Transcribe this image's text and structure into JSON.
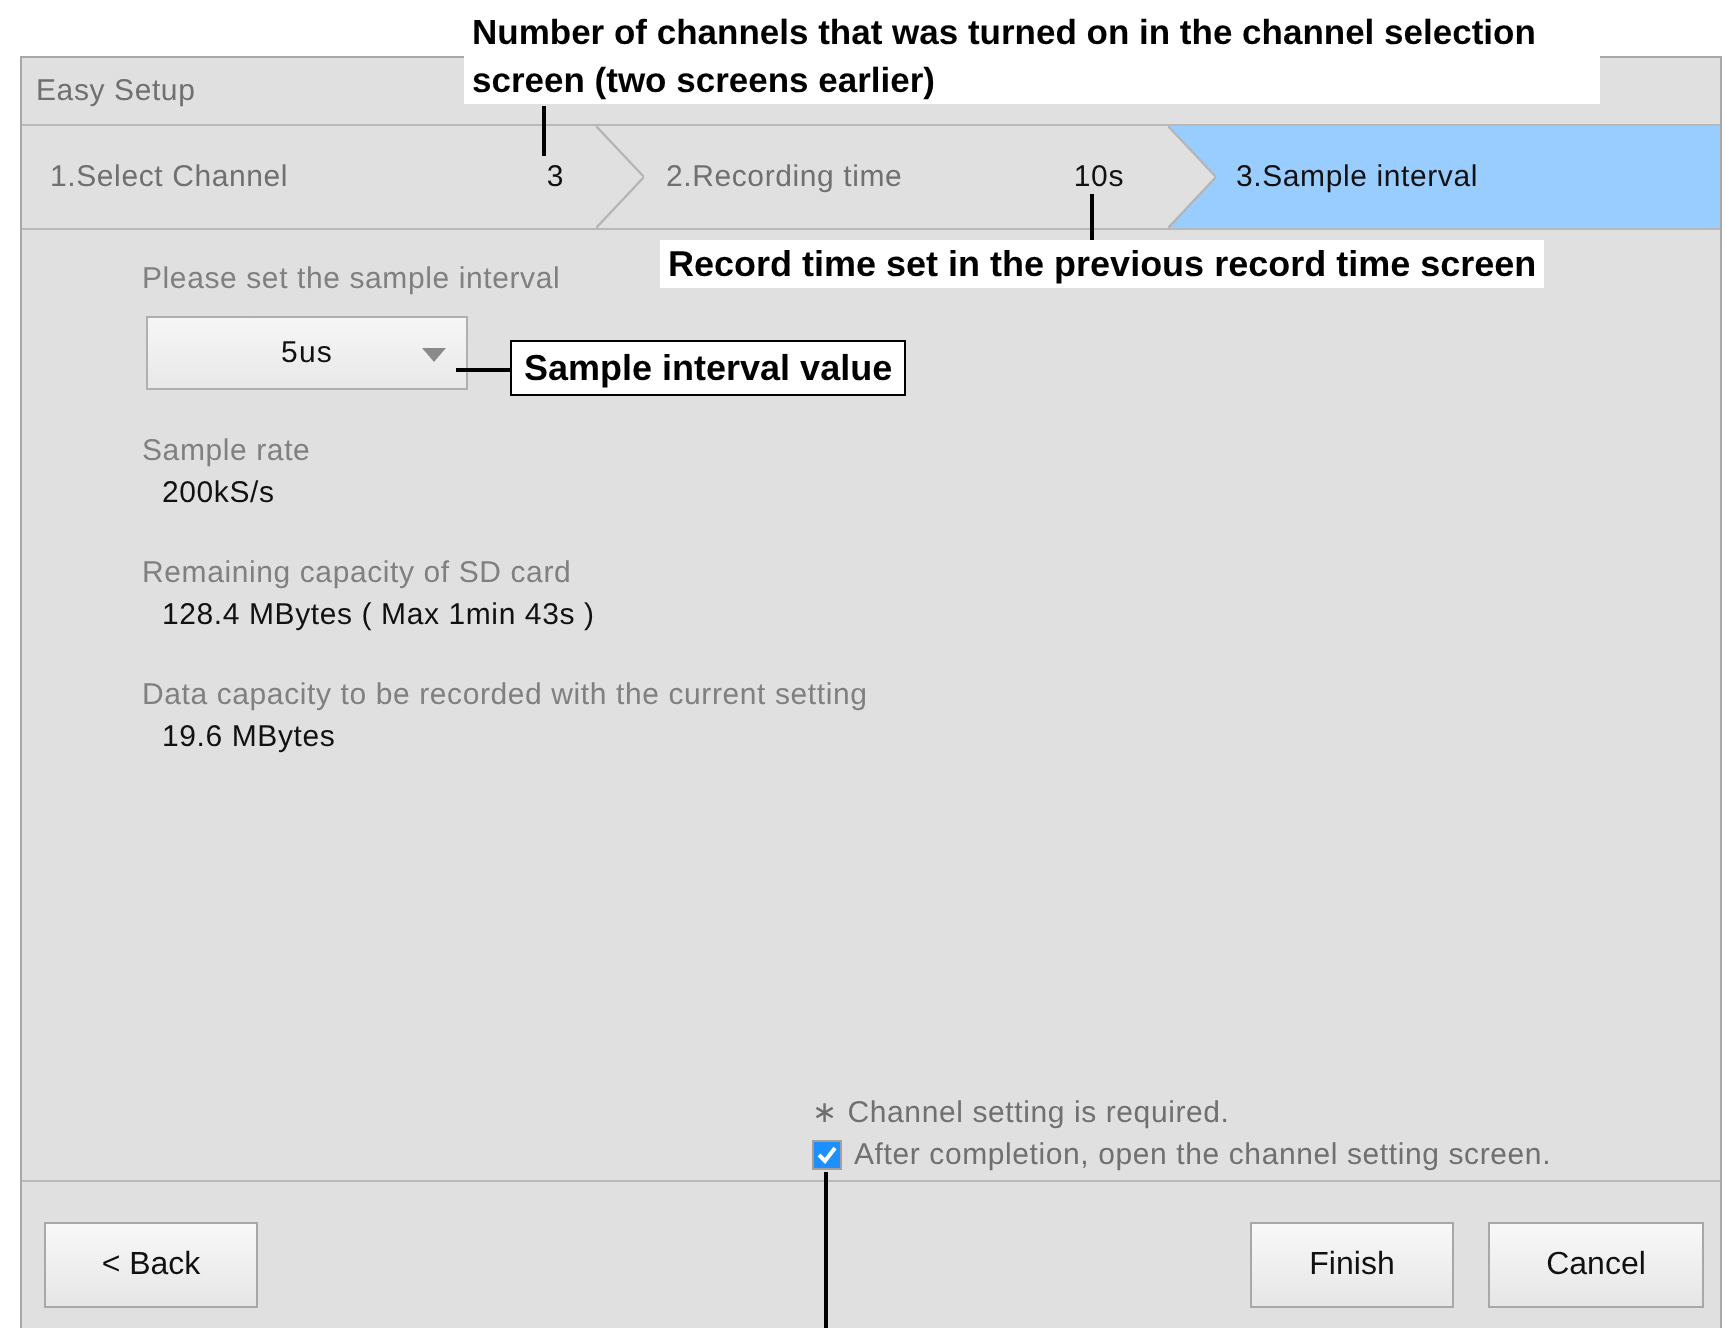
{
  "window": {
    "title": "Easy Setup"
  },
  "steps": [
    {
      "label": "1.Select Channel",
      "value": "3",
      "selected": false
    },
    {
      "label": "2.Recording time",
      "value": "10s",
      "selected": false
    },
    {
      "label": "3.Sample interval",
      "selected": true
    }
  ],
  "prompt": "Please set the sample interval",
  "dropdown": {
    "value": "5us"
  },
  "info": [
    {
      "label": "Sample rate",
      "value": "200kS/s"
    },
    {
      "label": "Remaining capacity of SD card",
      "value": "128.4 MBytes ( Max 1min 43s )"
    },
    {
      "label": "Data capacity to be recorded with the current setting",
      "value": "19.6 MBytes"
    }
  ],
  "note": "∗ Channel setting is required.",
  "checkbox": {
    "label": "After completion, open the channel setting screen.",
    "checked": true
  },
  "buttons": [
    {
      "kind": "back",
      "label": "< Back"
    },
    {
      "kind": "finish",
      "label": "Finish"
    },
    {
      "kind": "cancel",
      "label": "Cancel"
    }
  ],
  "callouts": [
    {
      "kind": "plain",
      "text": "Number of channels that was turned on in the channel selection screen (two screens earlier)"
    },
    {
      "kind": "plain",
      "text": "Record time set in the previous record time screen"
    },
    {
      "kind": "boxed",
      "text": "Sample interval value"
    }
  ]
}
